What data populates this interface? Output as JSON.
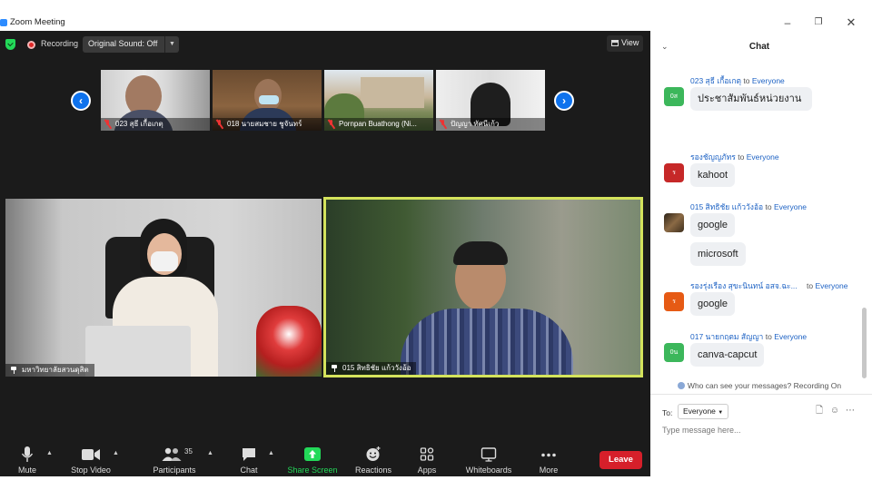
{
  "window": {
    "title": "Zoom Meeting"
  },
  "topbar": {
    "recording_label": "Recording",
    "original_sound_label": "Original Sound: Off",
    "view_label": "View"
  },
  "gallery": [
    {
      "name": "023  สุธี  เกื้อเกตุ"
    },
    {
      "name": "018 นายสมชาย  ชูจันทร์"
    },
    {
      "name": "Pornpan Buathong (Ni..."
    },
    {
      "name": "ปัญญา  ทัศนีเก้ว"
    }
  ],
  "videos": {
    "left_name": "มหาวิทยาลัยสวนดุสิต",
    "right_name": "015 สิทธิชัย แก้ววังอ้อ"
  },
  "toolbar": {
    "mute": "Mute",
    "stop_video": "Stop Video",
    "participants": "Participants",
    "participants_count": "35",
    "chat": "Chat",
    "share_screen": "Share Screen",
    "reactions": "Reactions",
    "apps": "Apps",
    "whiteboards": "Whiteboards",
    "more": "More",
    "leave": "Leave"
  },
  "chat": {
    "title": "Chat",
    "messages": [
      {
        "sender": "023  สุธี  เกื้อเกตุ",
        "to": "to",
        "target": "Everyone",
        "avatar": "0ส",
        "avatar_color": "#3cb75b",
        "texts": [
          "ประชาสัมพันธ์หน่วยงาน"
        ]
      },
      {
        "sender": "รองชัญญภัทร",
        "to": "to",
        "target": "Everyone",
        "avatar": "ร",
        "avatar_color": "#c62828",
        "texts": [
          "kahoot"
        ]
      },
      {
        "sender": "015 สิทธิชัย แก้ววังอ้อ",
        "to": "to",
        "target": "Everyone",
        "avatar": "",
        "avatar_color": "#5a4630",
        "texts": [
          "google",
          "microsoft"
        ]
      },
      {
        "sender": "รองรุ่งเรือง สุขะนินทน์ อสจ.ฉะ...",
        "to": "to",
        "target": "Everyone",
        "avatar": "ร",
        "avatar_color": "#e65a14",
        "texts": [
          "google"
        ]
      },
      {
        "sender": "017 นายกฤตม สัญญา",
        "to": "to",
        "target": "Everyone",
        "avatar": "0น",
        "avatar_color": "#3cb75b",
        "texts": [
          "canva-capcut"
        ]
      }
    ],
    "who_can_see": "Who can see your messages? Recording On",
    "to_label": "To:",
    "to_value": "Everyone",
    "input_placeholder": "Type message here..."
  },
  "colors": {
    "zoom_blue": "#0e72ed",
    "leave_red": "#d61f2a",
    "share_green": "#23d959",
    "active_speaker": "#d4e35c"
  }
}
